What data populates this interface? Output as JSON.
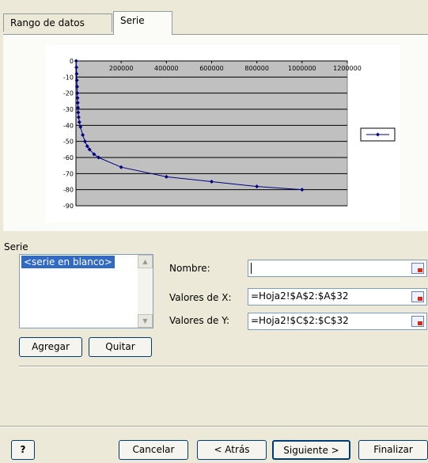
{
  "tabs": [
    {
      "label": "Rango de datos",
      "active": false
    },
    {
      "label": "Serie",
      "active": true
    }
  ],
  "chart_data": {
    "type": "scatter",
    "x": [
      1000,
      2000,
      3000,
      4000,
      5000,
      6000,
      7000,
      8000,
      9000,
      10000,
      12000,
      15000,
      20000,
      30000,
      40000,
      50000,
      60000,
      80000,
      100000,
      200000,
      400000,
      600000,
      800000,
      1000000
    ],
    "y": [
      0,
      -4,
      -8,
      -12,
      -16,
      -20,
      -23,
      -26,
      -29,
      -32,
      -35,
      -38,
      -41,
      -46,
      -50,
      -53,
      -55,
      -58,
      -60,
      -66,
      -72,
      -75,
      -78,
      -80
    ],
    "xticks": [
      "0",
      "200000",
      "400000",
      "600000",
      "800000",
      "1000000",
      "1200000"
    ],
    "yticks": [
      "0",
      "-10",
      "-20",
      "-30",
      "-40",
      "-50",
      "-60",
      "-70",
      "-80",
      "-90"
    ],
    "xlim": [
      0,
      1200000
    ],
    "ylim": [
      -90,
      0
    ],
    "grid": true,
    "legend": "right",
    "colors": {
      "series": "#000080",
      "plot_bg": "#c0c0c0"
    }
  },
  "serie": {
    "group_label": "Serie",
    "list_items": [
      "<serie en blanco>"
    ],
    "add_label": "Agregar",
    "remove_label": "Quitar"
  },
  "fields": {
    "name_label": "Nombre:",
    "name_value": "",
    "x_label": "Valores de X:",
    "x_value": "=Hoja2!$A$2:$A$32",
    "y_label": "Valores de Y:",
    "y_value": "=Hoja2!$C$2:$C$32"
  },
  "buttons": {
    "help": "?",
    "cancel": "Cancelar",
    "back": "< Atrás",
    "next": "Siguiente >",
    "finish": "Finalizar"
  }
}
